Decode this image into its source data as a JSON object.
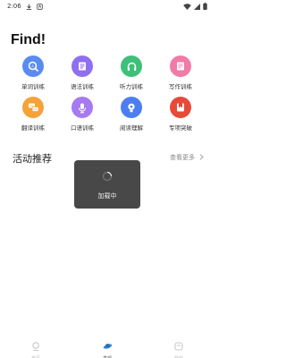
{
  "status_bar": {
    "time": "2:06"
  },
  "page_title": "Find!",
  "grid": [
    {
      "label": "单词训练",
      "icon": "word-training-icon",
      "color": "#5a8cf0"
    },
    {
      "label": "语法训练",
      "icon": "grammar-training-icon",
      "color": "#8f6ff0"
    },
    {
      "label": "听力训练",
      "icon": "listening-training-icon",
      "color": "#3fc07a"
    },
    {
      "label": "写作训练",
      "icon": "writing-training-icon",
      "color": "#f07aa8"
    },
    {
      "label": "翻译训练",
      "icon": "translation-training-icon",
      "color": "#f5a238"
    },
    {
      "label": "口语训练",
      "icon": "speaking-training-icon",
      "color": "#a67af0"
    },
    {
      "label": "阅读理解",
      "icon": "reading-comprehension-icon",
      "color": "#4c7ef0"
    },
    {
      "label": "专项突破",
      "icon": "special-breakthrough-icon",
      "color": "#e84a3a"
    }
  ],
  "activity": {
    "title": "活动推荐",
    "see_more": "查看更多"
  },
  "toast": {
    "label": "加载中"
  },
  "bottom_nav": [
    {
      "label": "首页",
      "icon": "home-icon",
      "active": false
    },
    {
      "label": "发现",
      "icon": "discover-icon",
      "active": true
    },
    {
      "label": "我的",
      "icon": "profile-icon",
      "active": false
    }
  ],
  "colors": {
    "accent": "#3b8cd8",
    "inactive": "#c8c8c8"
  }
}
